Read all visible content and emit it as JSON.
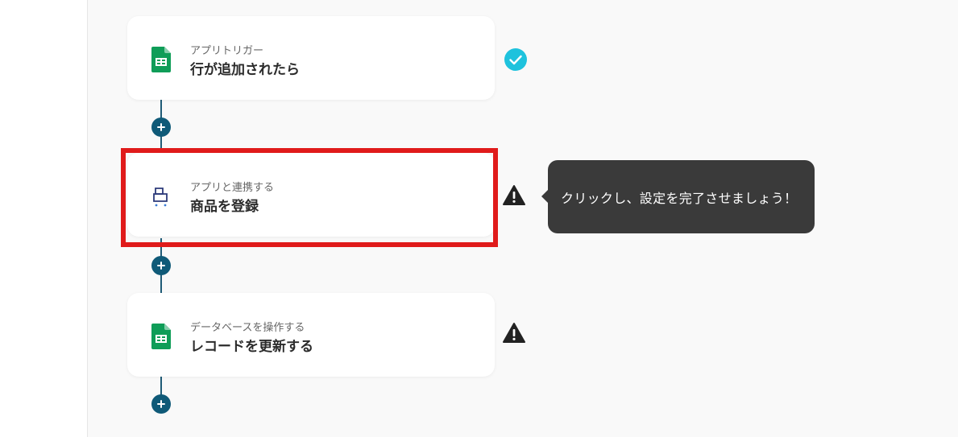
{
  "steps": [
    {
      "subtitle": "アプリトリガー",
      "title": "行が追加されたら",
      "icon": "google-sheets-icon",
      "status": "complete"
    },
    {
      "subtitle": "アプリと連携する",
      "title": "商品を登録",
      "icon": "shop-app-icon",
      "status": "warning"
    },
    {
      "subtitle": "データベースを操作する",
      "title": "レコードを更新する",
      "icon": "google-sheets-icon",
      "status": "warning"
    }
  ],
  "tooltip": {
    "text": "クリックし、設定を完了させましょう！"
  },
  "colors": {
    "connector": "#1f5b77",
    "plus_button": "#0f5a78",
    "check": "#1ec2dd",
    "warning": "#222222",
    "highlight": "#e01b1b",
    "sheets_green": "#0f9d58"
  }
}
